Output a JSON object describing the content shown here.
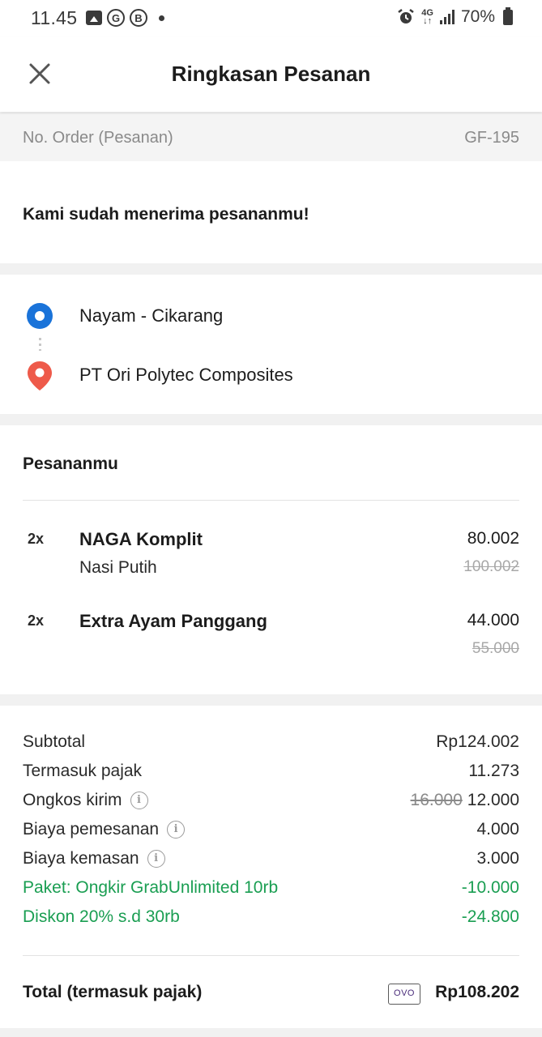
{
  "status_bar": {
    "time": "11.45",
    "network": "4G",
    "battery": "70%"
  },
  "header": {
    "title": "Ringkasan Pesanan"
  },
  "order": {
    "label": "No. Order (Pesanan)",
    "number": "GF-195"
  },
  "confirmation": "Kami sudah menerima pesananmu!",
  "route": {
    "origin": "Nayam - Cikarang",
    "destination": "PT Ori Polytec Composites"
  },
  "items_section": {
    "title": "Pesananmu",
    "items": [
      {
        "qty": "2x",
        "name": "NAGA Komplit",
        "note": "Nasi Putih",
        "price": "80.002",
        "original_price": "100.002"
      },
      {
        "qty": "2x",
        "name": "Extra Ayam Panggang",
        "note": "",
        "price": "44.000",
        "original_price": "55.000"
      }
    ]
  },
  "summary": {
    "subtotal": {
      "label": "Subtotal",
      "value": "Rp124.002"
    },
    "tax": {
      "label": "Termasuk pajak",
      "value": "11.273"
    },
    "delivery": {
      "label": "Ongkos kirim",
      "original": "16.000",
      "value": "12.000"
    },
    "order_fee": {
      "label": "Biaya pemesanan",
      "value": "4.000"
    },
    "packaging": {
      "label": "Biaya kemasan",
      "value": "3.000"
    },
    "package_discount": {
      "label": "Paket: Ongkir GrabUnlimited 10rb",
      "value": "-10.000"
    },
    "discount": {
      "label": "Diskon 20% s.d 30rb",
      "value": "-24.800"
    },
    "total": {
      "label": "Total (termasuk pajak)",
      "payment_method": "OVO",
      "value": "Rp108.202"
    }
  },
  "colors": {
    "discount_green": "#1a9e52",
    "origin_blue": "#1a73d9",
    "destination_red": "#ee5a4a"
  }
}
